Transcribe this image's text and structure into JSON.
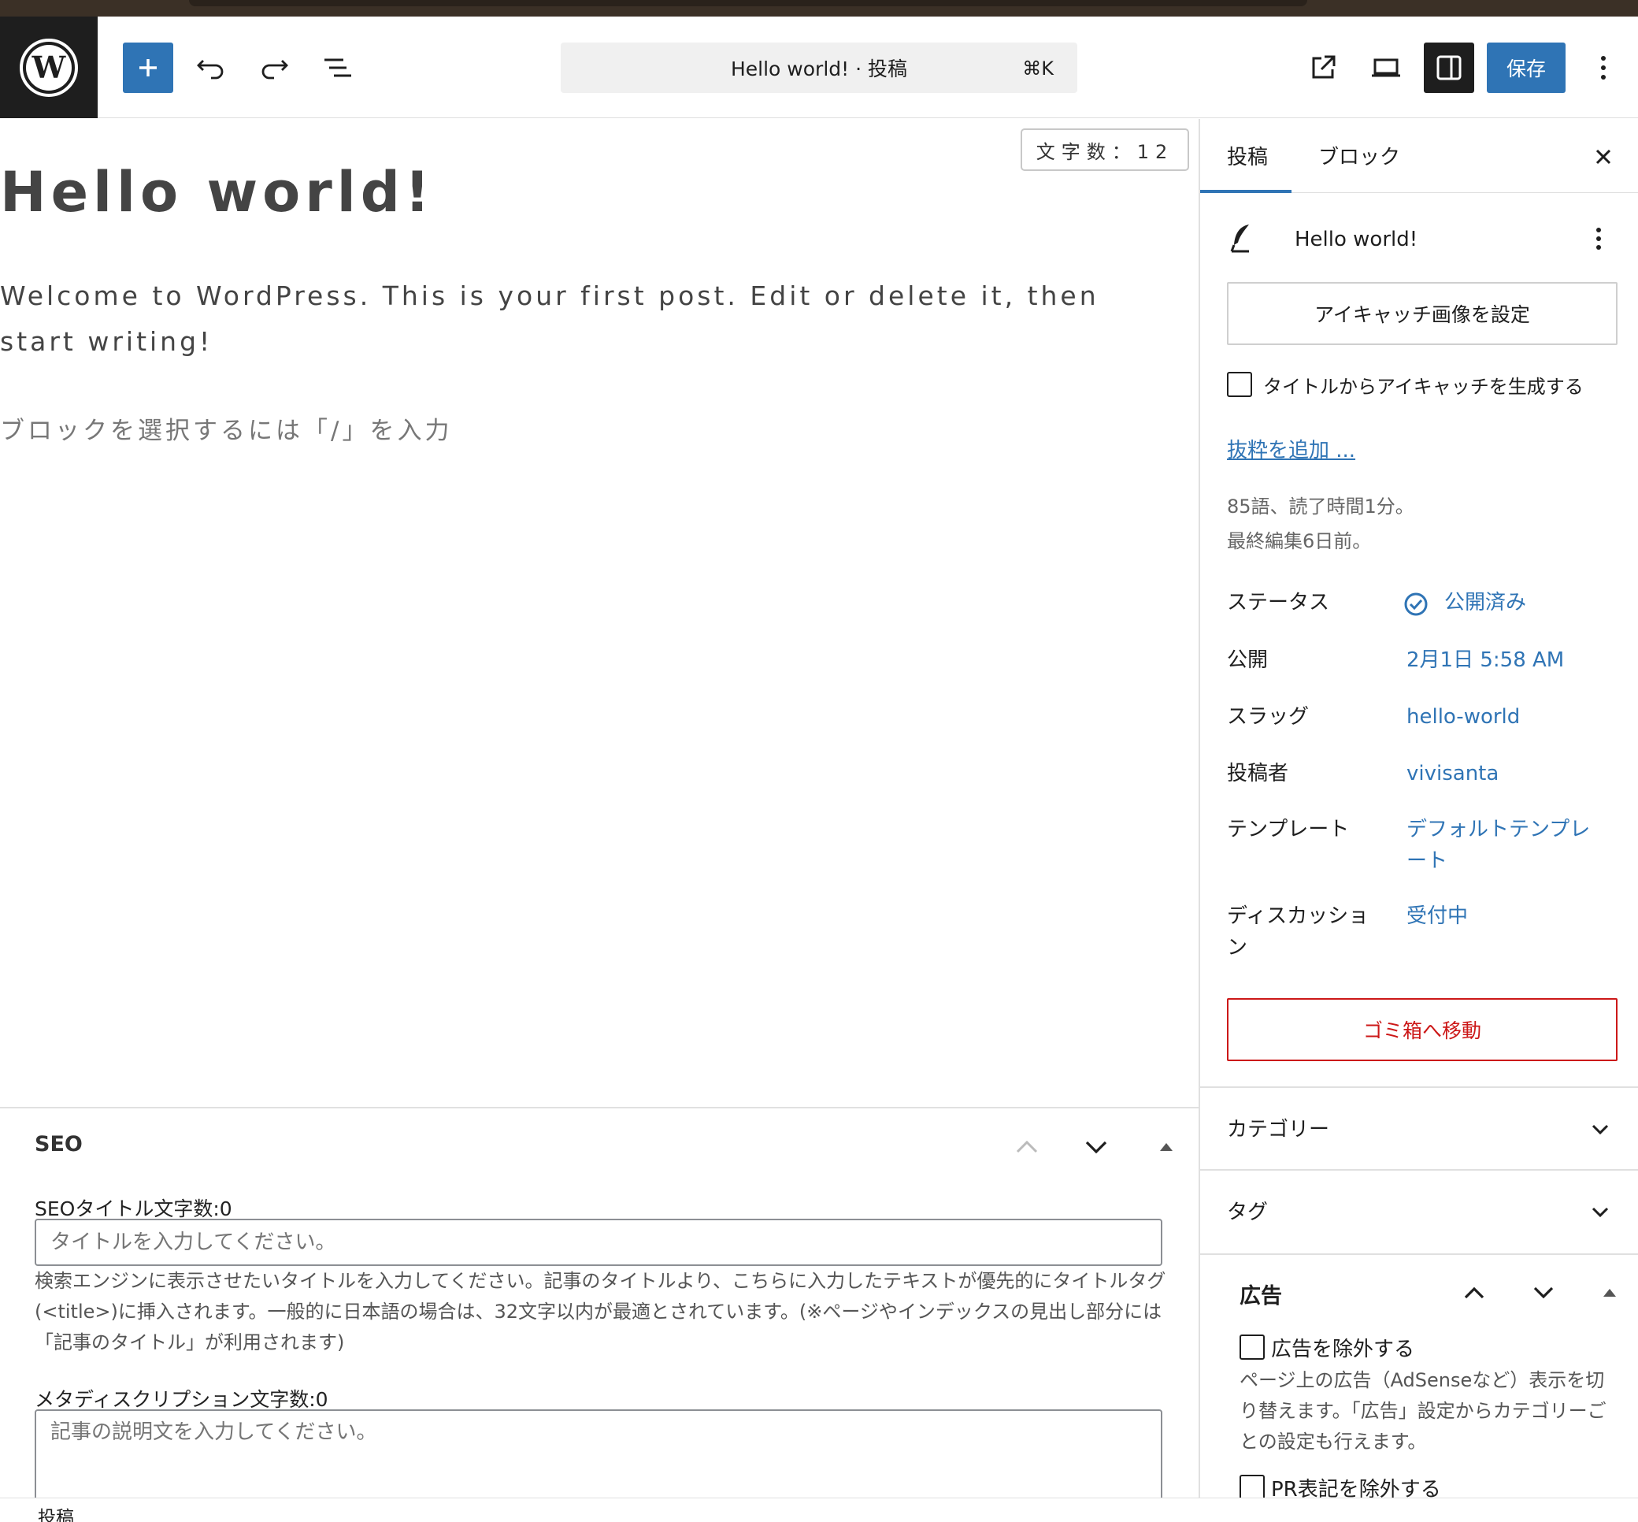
{
  "header": {
    "document_title": "Hello world! · 投稿",
    "shortcut": "⌘K",
    "save_label": "保存"
  },
  "editor": {
    "word_count": "文字数：12",
    "title": "Hello world!",
    "body": "Welcome to WordPress. This is your first post. Edit or delete it, then start writing!",
    "block_placeholder": "ブロックを選択するには「/」を入力"
  },
  "seo": {
    "title": "SEO",
    "title_count_label": "SEOタイトル文字数:0",
    "title_placeholder": "タイトルを入力してください。",
    "help": "検索エンジンに表示させたいタイトルを入力してください。記事のタイトルより、こちらに入力したテキストが優先的にタイトルタグ(<title>)に挿入されます。一般的に日本語の場合は、32文字以内が最適とされています。(※ページやインデックスの見出し部分には「記事のタイトル」が利用されます)",
    "desc_count_label": "メタディスクリプション文字数:0",
    "desc_placeholder": "記事の説明文を入力してください。"
  },
  "statusbar": {
    "label": "投稿"
  },
  "sidebar": {
    "tab_post": "投稿",
    "tab_block": "ブロック",
    "post_title": "Hello world!",
    "featured_button": "アイキャッチ画像を設定",
    "generate_checkbox": "タイトルからアイキャッチを生成する",
    "excerpt_link": "抜粋を追加 ...",
    "meta_words": "85語、読了時間1分。",
    "meta_edited": "最終編集6日前。",
    "rows": [
      {
        "key": "ステータス",
        "value": "公開済み"
      },
      {
        "key": "公開",
        "value": "2月1日 5:58 AM"
      },
      {
        "key": "スラッグ",
        "value": "hello-world"
      },
      {
        "key": "投稿者",
        "value": "vivisanta"
      },
      {
        "key": "テンプレート",
        "value": "デフォルトテンプレート"
      },
      {
        "key": "ディスカッション",
        "value": "受付中"
      }
    ],
    "trash_button": "ゴミ箱へ移動",
    "category_panel": "カテゴリー",
    "tag_panel": "タグ",
    "ad": {
      "title": "広告",
      "exclude_label": "広告を除外する",
      "help": "ページ上の広告（AdSenseなど）表示を切り替えます。「広告」設定からカテゴリーごとの設定も行えます。",
      "pr_label": "PR表記を除外する"
    }
  },
  "colors": {
    "accent": "#2f74b5",
    "danger": "#cc1818",
    "dark": "#1e1e1e"
  }
}
